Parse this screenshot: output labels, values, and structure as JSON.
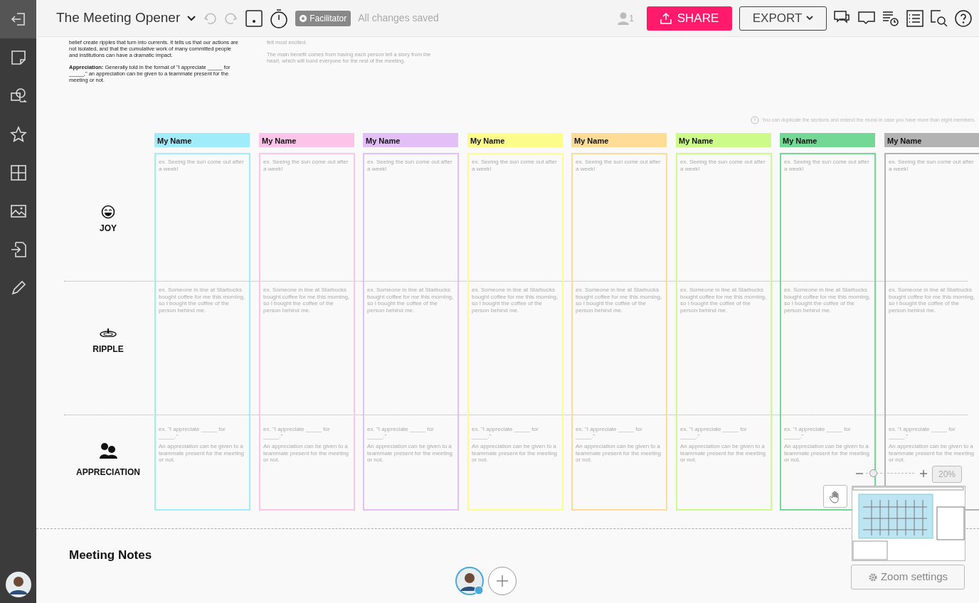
{
  "toolbar": {
    "title": "The Meeting Opener",
    "badge": "Facilitator",
    "status": "All changes saved",
    "user_count": "1",
    "share": "SHARE",
    "export": "EXPORT"
  },
  "intro": {
    "left": [
      "belief create ripples that turn into currents. It tells us that our actions are not isolated, and that the cumulative work of many committed people and institutions can have a dramatic impact.",
      "**Appreciation:** Generally told in the format of \"I appreciate _____ for _____,\" an appreciation can be given to a teammate present for the meeting or not."
    ],
    "right": [
      "felt most excited.",
      "The main benefit comes from having each person tell a story from the heart, which will bond everyone for the rest of the meeting."
    ]
  },
  "info_note": "You can duplicate the sections and extend the mural in case you have more than eight members.",
  "sections": [
    {
      "kind": "joy",
      "label": "JOY"
    },
    {
      "kind": "ripple",
      "label": "RIPPLE"
    },
    {
      "kind": "appreciation",
      "label": "APPRECIATION"
    }
  ],
  "members": [
    {
      "name": "My Name",
      "color": "#a0ecfb",
      "cells": [
        {
          "example": "ex. Seeing the sun come out after a week!"
        },
        {
          "example": "ex. Someone in line at Starbucks bought coffee for me this morning, so I bought the coffee of the person behind me."
        },
        {
          "example": "ex. \"I appreciate _____ for _____.\"",
          "note": "An appreciation can be given to a teammate present for the meeting or not."
        }
      ]
    },
    {
      "name": "My Name",
      "color": "#fdc4ea",
      "cells": [
        {
          "example": "ex. Seeing the sun come out after a week!"
        },
        {
          "example": "ex. Someone in line at Starbucks bought coffee for me this morning, so I bought the coffee of the person behind me."
        },
        {
          "example": "ex. \"I appreciate _____ for _____.\"",
          "note": "An appreciation can be given to a teammate present for the meeting or not."
        }
      ]
    },
    {
      "name": "My Name",
      "color": "#e3bff8",
      "cells": [
        {
          "example": "ex. Seeing the sun come out after a week!"
        },
        {
          "example": "ex. Someone in line at Starbucks bought coffee for me this morning, so I bought the coffee of the person behind me."
        },
        {
          "example": "ex. \"I appreciate _____ for _____.\"",
          "note": "An appreciation can be given to a teammate present for the meeting or not."
        }
      ]
    },
    {
      "name": "My Name",
      "color": "#fcfc8a",
      "cells": [
        {
          "example": "ex. Seeing the sun come out after a week!"
        },
        {
          "example": "ex. Someone in line at Starbucks bought coffee for me this morning, so I bought the coffee of the person behind me."
        },
        {
          "example": "ex. \"I appreciate _____ for _____.\"",
          "note": "An appreciation can be given to a teammate present for the meeting or not."
        }
      ]
    },
    {
      "name": "My Name",
      "color": "#fedc95",
      "cells": [
        {
          "example": "ex. Seeing the sun come out after a week!"
        },
        {
          "example": "ex. Someone in line at Starbucks bought coffee for me this morning, so I bought the coffee of the person behind me."
        },
        {
          "example": "ex. \"I appreciate _____ for _____.\"",
          "note": "An appreciation can be given to a teammate present for the meeting or not."
        }
      ]
    },
    {
      "name": "My Name",
      "color": "#cdfb8a",
      "cells": [
        {
          "example": "ex. Seeing the sun come out after a week!"
        },
        {
          "example": "ex. Someone in line at Starbucks bought coffee for me this morning, so I bought the coffee of the person behind me."
        },
        {
          "example": "ex. \"I appreciate _____ for _____.\"",
          "note": "An appreciation can be given to a teammate present for the meeting or not."
        }
      ]
    },
    {
      "name": "My Name",
      "color": "#73d896",
      "cells": [
        {
          "example": "ex. Seeing the sun come out after a week!"
        },
        {
          "example": "ex. Someone in line at Starbucks bought coffee for me this morning, so I bought the coffee of the person behind me."
        },
        {
          "example": "ex. \"I appreciate _____ for _____.\"",
          "note": "An appreciation can be given to a teammate present for the meeting or not."
        }
      ]
    },
    {
      "name": "My Name",
      "color": "#b3b3b3",
      "cells": [
        {
          "example": "ex. Seeing the sun come out after a week!"
        },
        {
          "example": "ex. Someone in line at Starbucks bought coffee for me this morning, so I bought the coffee of the person behind me."
        },
        {
          "example": "ex. \"I appreciate _____ for _____.\"",
          "note": "An appreciation can be given to a teammate present for the meeting or not."
        }
      ]
    }
  ],
  "notes_title": "Meeting Notes",
  "zoom": {
    "level": 0.15,
    "reading": "20%",
    "settings": "Zoom settings"
  }
}
